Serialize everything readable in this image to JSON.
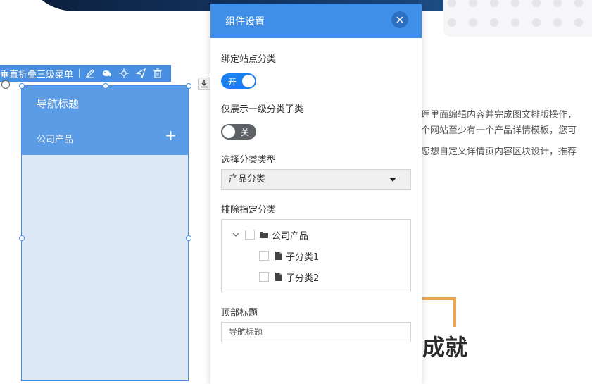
{
  "background": {
    "text_lines": [
      "管理里面编辑内容并完成图文排版操作，",
      "一个网站至少有一个产品详情模板，您可",
      "果您想自定义详情页内容区块设计，推荐"
    ],
    "heading": "成就"
  },
  "component_toolbar": {
    "title": "垂直折叠三级菜单",
    "icons": [
      "edit-icon",
      "style-icon",
      "move-icon",
      "send-icon",
      "trash-icon"
    ]
  },
  "nav_widget": {
    "title": "导航标题",
    "items": [
      {
        "label": "公司产品",
        "expand": "+"
      }
    ]
  },
  "panel": {
    "title": "组件设置",
    "bind_category": {
      "label": "绑定站点分类",
      "toggle_text": "开",
      "on": true
    },
    "first_level_only": {
      "label": "仅展示一级分类子类",
      "toggle_text": "关",
      "on": false
    },
    "category_type": {
      "label": "选择分类类型",
      "selected": "产品分类"
    },
    "exclude": {
      "label": "排除指定分类",
      "tree": [
        {
          "label": "公司产品",
          "type": "folder",
          "children": [
            {
              "label": "子分类1",
              "type": "file"
            },
            {
              "label": "子分类2",
              "type": "file"
            }
          ]
        }
      ]
    },
    "top_title": {
      "label": "顶部标题",
      "value": "导航标题"
    }
  },
  "colors": {
    "primary": "#3f8fe8",
    "toolbar": "#4a90e2",
    "toggle_on": "#1a7ff0",
    "toggle_off": "#5e6166",
    "accent_orange": "#f0a650"
  }
}
